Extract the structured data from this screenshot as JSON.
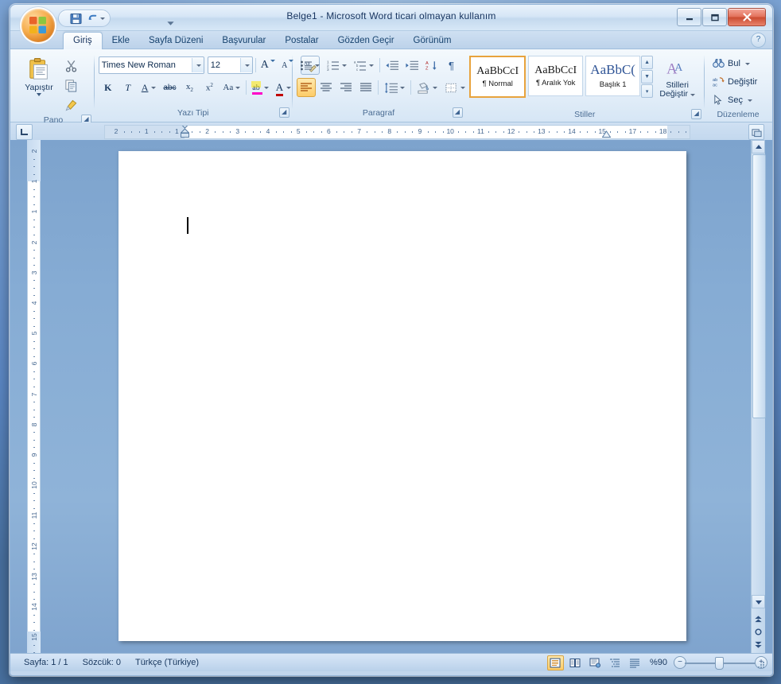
{
  "window": {
    "title": "Belge1 - Microsoft Word ticari olmayan kullanım",
    "minimize_label": "—",
    "maximize_label": "❐",
    "close_label": "✕"
  },
  "office_button": {
    "name": "Office Düğmesi"
  },
  "quick_access": {
    "save_label": "Kaydet",
    "undo_label": "Geri Al",
    "customize_label": "Hızlı Erişim Araç Çubuğunu Özelleştir"
  },
  "help": {
    "label": "?"
  },
  "tabs": [
    {
      "label": "Giriş",
      "active": true
    },
    {
      "label": "Ekle",
      "active": false
    },
    {
      "label": "Sayfa Düzeni",
      "active": false
    },
    {
      "label": "Başvurular",
      "active": false
    },
    {
      "label": "Postalar",
      "active": false
    },
    {
      "label": "Gözden Geçir",
      "active": false
    },
    {
      "label": "Görünüm",
      "active": false
    }
  ],
  "ribbon": {
    "clipboard": {
      "group_label": "Pano",
      "paste_label": "Yapıştır",
      "cut_label": "Kes",
      "copy_label": "Kopyala",
      "format_painter_label": "Biçim Boyacısı"
    },
    "font": {
      "group_label": "Yazı Tipi",
      "font_name": "Times New Roman",
      "font_size": "12",
      "grow_label": "A",
      "shrink_label": "A",
      "clear_format_label": "Biçimlendirmeyi Temizle",
      "bold_label": "K",
      "italic_label": "T",
      "underline_label": "A",
      "strikethrough_label": "abc",
      "subscript_label": "x",
      "superscript_label": "x",
      "change_case_label": "Aa",
      "highlight_label": "ab",
      "font_color_label": "A"
    },
    "paragraph": {
      "group_label": "Paragraf",
      "bullets_label": "Madde İşaretleri",
      "numbering_label": "Numaralandırma",
      "multilevel_label": "Çok Düzeyli Liste",
      "decrease_indent_label": "Girintiyi Azalt",
      "increase_indent_label": "Girintiyi Artır",
      "sort_label": "Sırala",
      "show_marks_label": "¶",
      "align_left_label": "Sola Hizala",
      "align_center_label": "Ortala",
      "align_right_label": "Sağa Hizala",
      "justify_label": "Yasla",
      "line_spacing_label": "Satır Aralığı",
      "shading_label": "Gölgelendirme",
      "borders_label": "Kenarlıklar"
    },
    "styles": {
      "group_label": "Stiller",
      "items": [
        {
          "sample": "AaBbCcI",
          "name": "¶ Normal",
          "selected": true,
          "heading": false
        },
        {
          "sample": "AaBbCcI",
          "name": "¶ Aralık Yok",
          "selected": false,
          "heading": false
        },
        {
          "sample": "AaBbC(",
          "name": "Başlık 1",
          "selected": false,
          "heading": true
        }
      ],
      "change_styles_label_1": "Stilleri",
      "change_styles_label_2": "Değiştir",
      "scroll_up_label": "▲",
      "scroll_down_label": "▼",
      "more_label": "▼"
    },
    "editing": {
      "group_label": "Düzenleme",
      "find_label": "Bul",
      "replace_label": "Değiştir",
      "select_label": "Seç"
    },
    "dialog_launcher_label": "↘"
  },
  "ruler": {
    "tab_stop_label": "Sekme Durağı",
    "view_options_label": "Cetvel",
    "h_ticks": [
      "2",
      "1",
      "1",
      "2",
      "3",
      "4",
      "5",
      "6",
      "7",
      "8",
      "9",
      "10",
      "11",
      "12",
      "13",
      "14",
      "15",
      "17",
      "18"
    ],
    "v_ticks": [
      "2",
      "1",
      "1",
      "2",
      "3",
      "4",
      "5",
      "6",
      "7",
      "8",
      "9",
      "10",
      "11",
      "12",
      "13",
      "14",
      "15"
    ]
  },
  "document": {
    "content": "",
    "caret_visible": true
  },
  "scrollbar": {
    "up_label": "▲",
    "down_label": "▼",
    "prev_page_label": "▲",
    "select_object_label": "○",
    "next_page_label": "▼"
  },
  "status_bar": {
    "page_label": "Sayfa: 1 / 1",
    "word_count_label": "Sözcük: 0",
    "language_label": "Türkçe (Türkiye)",
    "zoom_label": "%90",
    "zoom_out_label": "−",
    "zoom_in_label": "+",
    "views": [
      {
        "name": "print-layout",
        "selected": true
      },
      {
        "name": "full-screen-reading",
        "selected": false
      },
      {
        "name": "web-layout",
        "selected": false
      },
      {
        "name": "outline",
        "selected": false
      },
      {
        "name": "draft",
        "selected": false
      }
    ]
  },
  "colors": {
    "accent": "#e8a33d",
    "title_text": "#16335e",
    "ribbon_bg": "#e5eff9",
    "page_bg": "#ffffff",
    "desktop": "#7ba3d4"
  }
}
